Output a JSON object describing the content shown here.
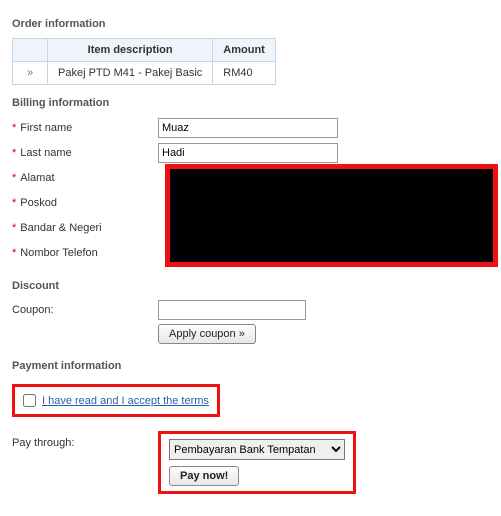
{
  "order": {
    "title": "Order information",
    "cols": {
      "item": "Item description",
      "amount": "Amount"
    },
    "arrow": "»",
    "rows": [
      {
        "item": "Pakej PTD M41 - Pakej Basic",
        "amount": "RM40"
      }
    ]
  },
  "billing": {
    "title": "Billing information",
    "fields": {
      "first_name": {
        "label": "First name",
        "value": "Muaz"
      },
      "last_name": {
        "label": "Last name",
        "value": "Hadi"
      },
      "alamat": {
        "label": "Alamat"
      },
      "poskod": {
        "label": "Poskod"
      },
      "bandar": {
        "label": "Bandar & Negeri"
      },
      "phone": {
        "label": "Nombor Telefon"
      }
    }
  },
  "discount": {
    "title": "Discount",
    "coupon_label": "Coupon:",
    "coupon_value": "",
    "apply_label": "Apply coupon »"
  },
  "payment": {
    "title": "Payment information",
    "terms_label": "I have read and I accept the terms",
    "pay_through_label": "Pay through:",
    "pay_method": "Pembayaran Bank Tempatan",
    "pay_now_label": "Pay now!"
  }
}
